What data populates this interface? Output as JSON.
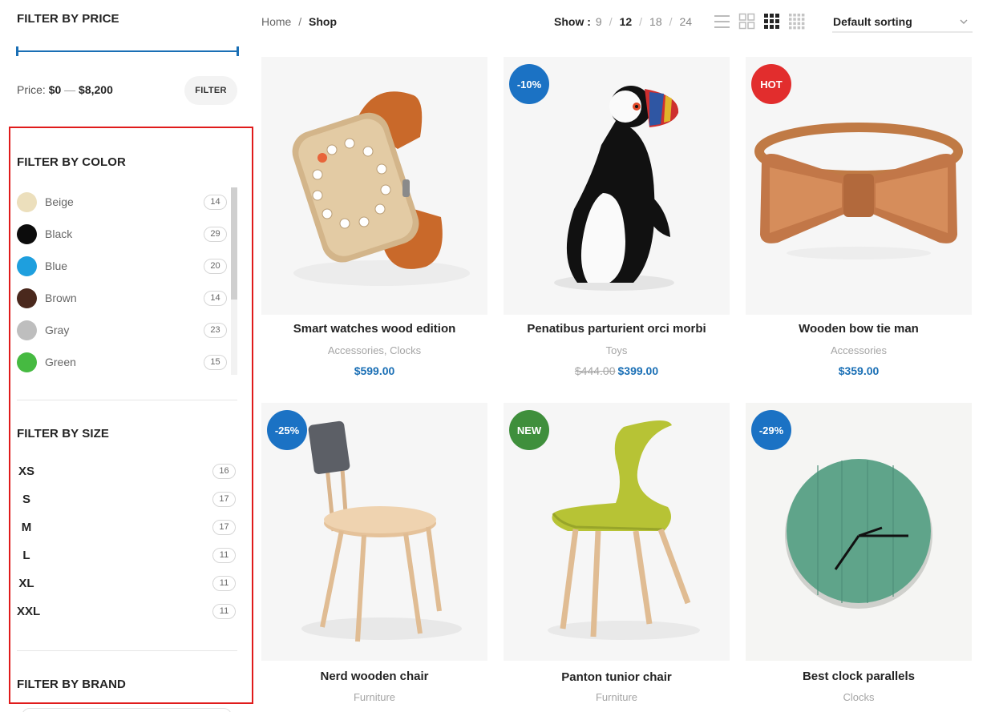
{
  "sidebar": {
    "price": {
      "title": "Filter by price",
      "label": "Price:",
      "min": "$0",
      "dash": "—",
      "max": "$8,200",
      "button": "Filter"
    },
    "color": {
      "title": "Filter by color",
      "items": [
        {
          "name": "Beige",
          "count": "14",
          "hex": "#ecdfbc"
        },
        {
          "name": "Black",
          "count": "29",
          "hex": "#0c0c0c"
        },
        {
          "name": "Blue",
          "count": "20",
          "hex": "#1e9fde"
        },
        {
          "name": "Brown",
          "count": "14",
          "hex": "#4a281d"
        },
        {
          "name": "Gray",
          "count": "23",
          "hex": "#bebebe"
        },
        {
          "name": "Green",
          "count": "15",
          "hex": "#46ba41"
        }
      ]
    },
    "size": {
      "title": "Filter by size",
      "items": [
        {
          "name": "XS",
          "count": "16"
        },
        {
          "name": "S",
          "count": "17"
        },
        {
          "name": "M",
          "count": "17"
        },
        {
          "name": "L",
          "count": "11"
        },
        {
          "name": "XL",
          "count": "11"
        },
        {
          "name": "XXL",
          "count": "11"
        }
      ]
    },
    "brand": {
      "title": "Filter by brand"
    }
  },
  "toolbar": {
    "breadcrumb": {
      "home": "Home",
      "sep": "/",
      "current": "Shop"
    },
    "show": {
      "label": "Show :",
      "options": [
        "9",
        "12",
        "18",
        "24"
      ],
      "active": "12",
      "sep": "/"
    },
    "view_icons": [
      "list-view-icon",
      "grid-2-icon",
      "grid-3-icon",
      "grid-4-icon"
    ],
    "sorting": "Default sorting"
  },
  "products": [
    {
      "name": "Smart watches wood edition",
      "categories": "Accessories, Clocks",
      "old_price": "",
      "price": "$599.00",
      "badge": "",
      "badge_color": ""
    },
    {
      "name": "Penatibus parturient orci morbi",
      "categories": "Toys",
      "old_price": "$444.00",
      "price": "$399.00",
      "badge": "-10%",
      "badge_color": "#1b72c4"
    },
    {
      "name": "Wooden bow tie man",
      "categories": "Accessories",
      "old_price": "",
      "price": "$359.00",
      "badge": "HOT",
      "badge_color": "#e22d2d"
    },
    {
      "name": "Nerd wooden chair",
      "categories": "Furniture",
      "old_price": "",
      "price": "",
      "badge": "-25%",
      "badge_color": "#1b72c4"
    },
    {
      "name": "Panton tunior chair",
      "categories": "Furniture",
      "old_price": "",
      "price": "",
      "badge": "NEW",
      "badge_color": "#3f8f3c"
    },
    {
      "name": "Best clock parallels",
      "categories": "Clocks",
      "old_price": "",
      "price": "",
      "badge": "-29%",
      "badge_color": "#1b72c4"
    }
  ],
  "colors": {
    "accent": "#1a6fb5",
    "highlight": "#e01b1b"
  }
}
